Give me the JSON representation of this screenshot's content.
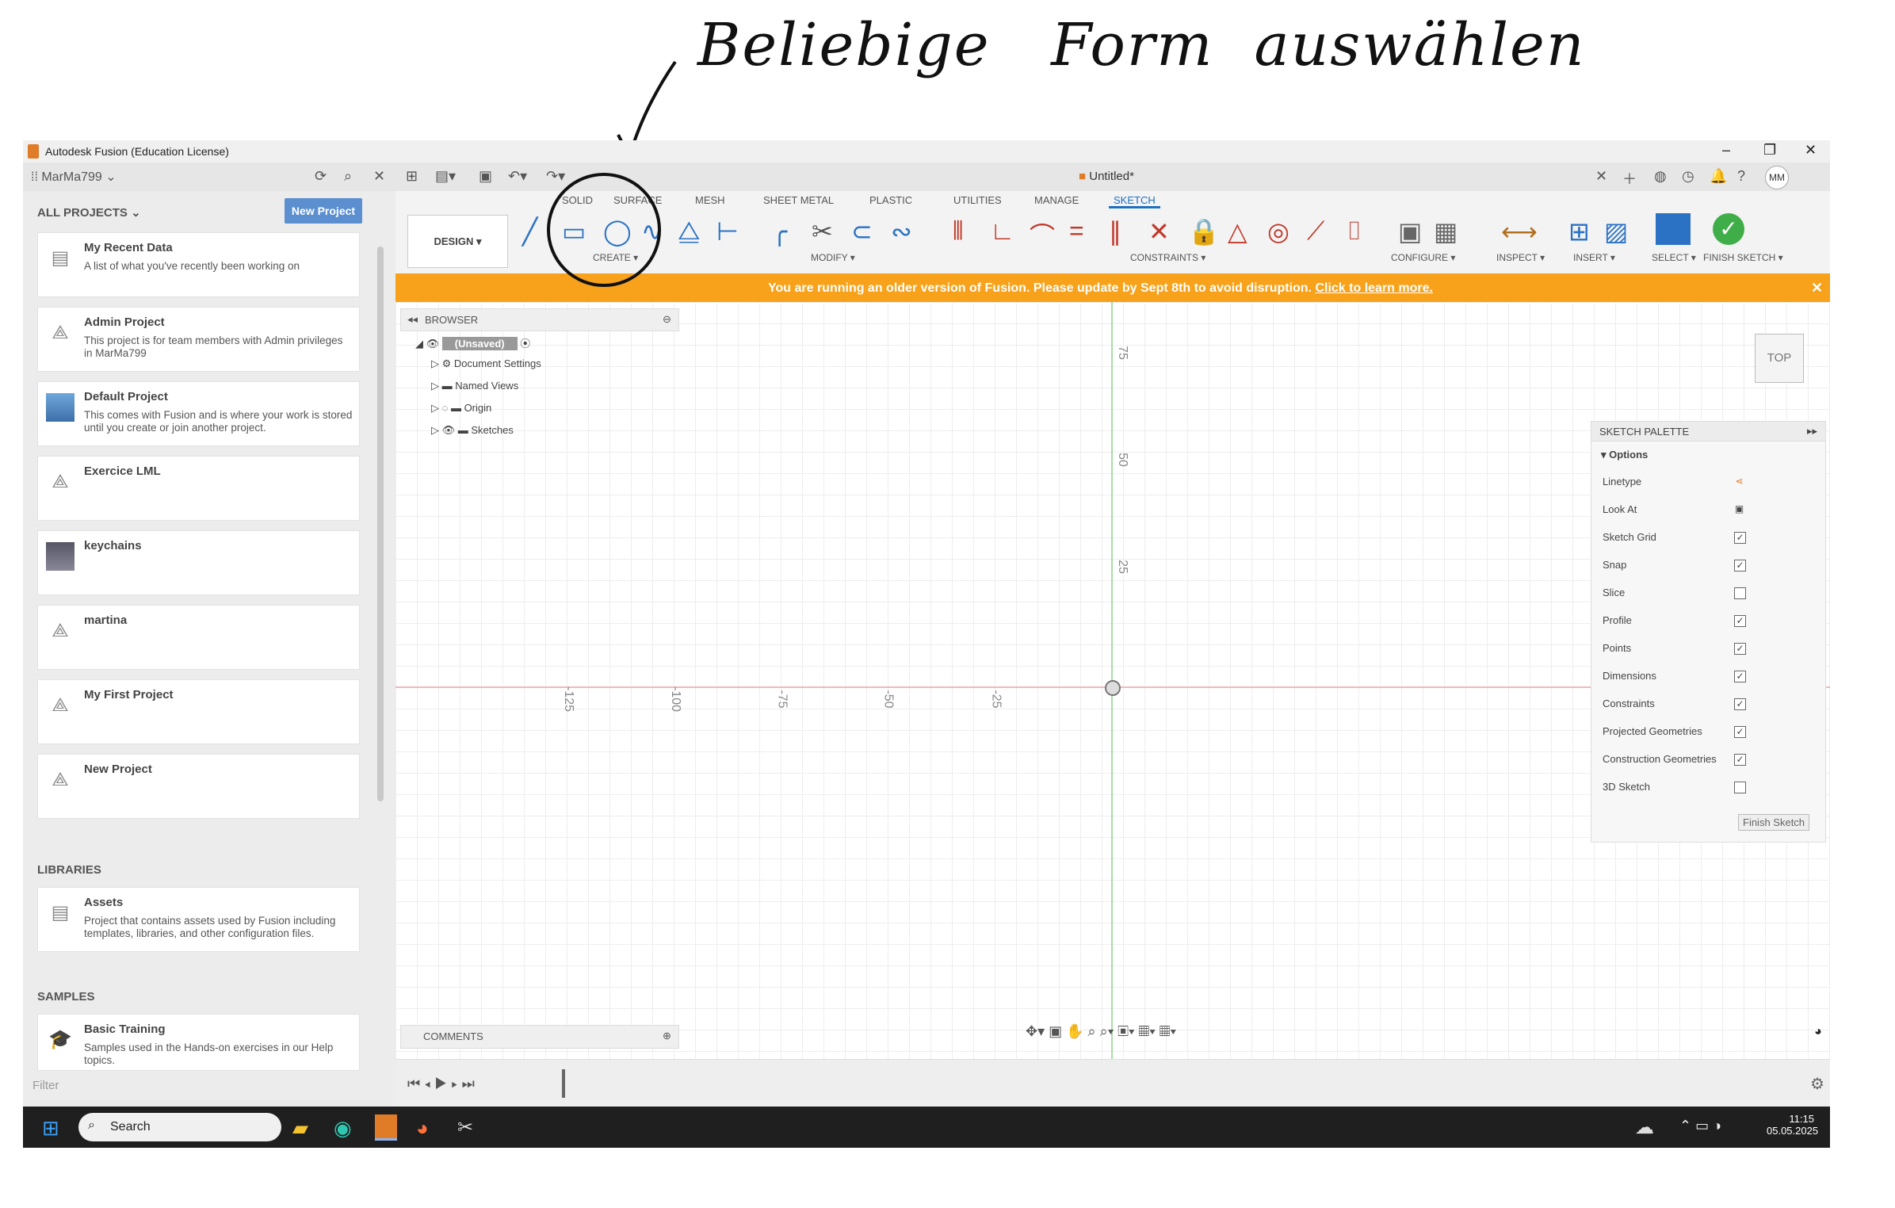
{
  "annotation": {
    "text": "Beliebige   Form  auswählen"
  },
  "window": {
    "title": "Autodesk Fusion (Education License)"
  },
  "topbar": {
    "user": "MarMa799",
    "doc_title": "Untitled*",
    "avatar": "MM"
  },
  "left_panel": {
    "all_projects": "ALL PROJECTS",
    "new_project": "New Project",
    "projects": [
      {
        "name": "My Recent Data",
        "desc": "A list of what you've recently been working on",
        "icon": "document-icon"
      },
      {
        "name": "Admin Project",
        "desc": "This project is for team members with Admin privileges in MarMa799",
        "icon": "project-icon"
      },
      {
        "name": "Default Project",
        "desc": "This comes with Fusion and is where your work is stored until you create or join another project.",
        "icon": "thumbnail"
      },
      {
        "name": "Exercice LML",
        "desc": "",
        "icon": "project-icon"
      },
      {
        "name": "keychains",
        "desc": "",
        "icon": "thumbnail"
      },
      {
        "name": "martina",
        "desc": "",
        "icon": "project-icon"
      },
      {
        "name": "My First Project",
        "desc": "",
        "icon": "project-icon"
      },
      {
        "name": "New Project",
        "desc": "",
        "icon": "project-icon"
      }
    ],
    "libraries_label": "LIBRARIES",
    "library": {
      "name": "Assets",
      "desc": "Project that contains assets used by Fusion including templates, libraries, and other configuration files."
    },
    "samples_label": "SAMPLES",
    "sample": {
      "name": "Basic Training",
      "desc": "Samples used in the Hands-on exercises in our Help topics."
    },
    "filter_placeholder": "Filter"
  },
  "tabs": [
    "SOLID",
    "SURFACE",
    "MESH",
    "SHEET METAL",
    "PLASTIC",
    "UTILITIES",
    "MANAGE",
    "SKETCH"
  ],
  "active_tab": "SKETCH",
  "ribbon": {
    "design": "DESIGN ▾",
    "groups": [
      "CREATE ▾",
      "MODIFY ▾",
      "CONSTRAINTS ▾",
      "CONFIGURE ▾",
      "INSPECT ▾",
      "INSERT ▾",
      "SELECT ▾",
      "FINISH SKETCH ▾"
    ]
  },
  "banner": {
    "text": "You are running an older version of Fusion. Please update by Sept 8th to avoid disruption. ",
    "link": "Click to learn more."
  },
  "browser": {
    "title": "BROWSER",
    "root": "(Unsaved)",
    "items": [
      "Document Settings",
      "Named Views",
      "Origin",
      "Sketches"
    ]
  },
  "axis_labels": {
    "x": [
      "-125",
      "-100",
      "-75",
      "-50",
      "-25"
    ],
    "y": [
      "75",
      "50",
      "25"
    ]
  },
  "viewcube": "TOP",
  "palette": {
    "title": "SKETCH PALETTE",
    "options": "Options",
    "rows": [
      {
        "label": "Linetype",
        "type": "icon"
      },
      {
        "label": "Look At",
        "type": "icon"
      },
      {
        "label": "Sketch Grid",
        "checked": true
      },
      {
        "label": "Snap",
        "checked": true
      },
      {
        "label": "Slice",
        "checked": false
      },
      {
        "label": "Profile",
        "checked": true
      },
      {
        "label": "Points",
        "checked": true
      },
      {
        "label": "Dimensions",
        "checked": true
      },
      {
        "label": "Constraints",
        "checked": true
      },
      {
        "label": "Projected Geometries",
        "checked": true
      },
      {
        "label": "Construction Geometries",
        "checked": true
      },
      {
        "label": "3D Sketch",
        "checked": false
      }
    ],
    "finish_button": "Finish Sketch"
  },
  "comments": "COMMENTS",
  "taskbar": {
    "search": "Search",
    "time": "11:15",
    "date": "05.05.2025"
  }
}
